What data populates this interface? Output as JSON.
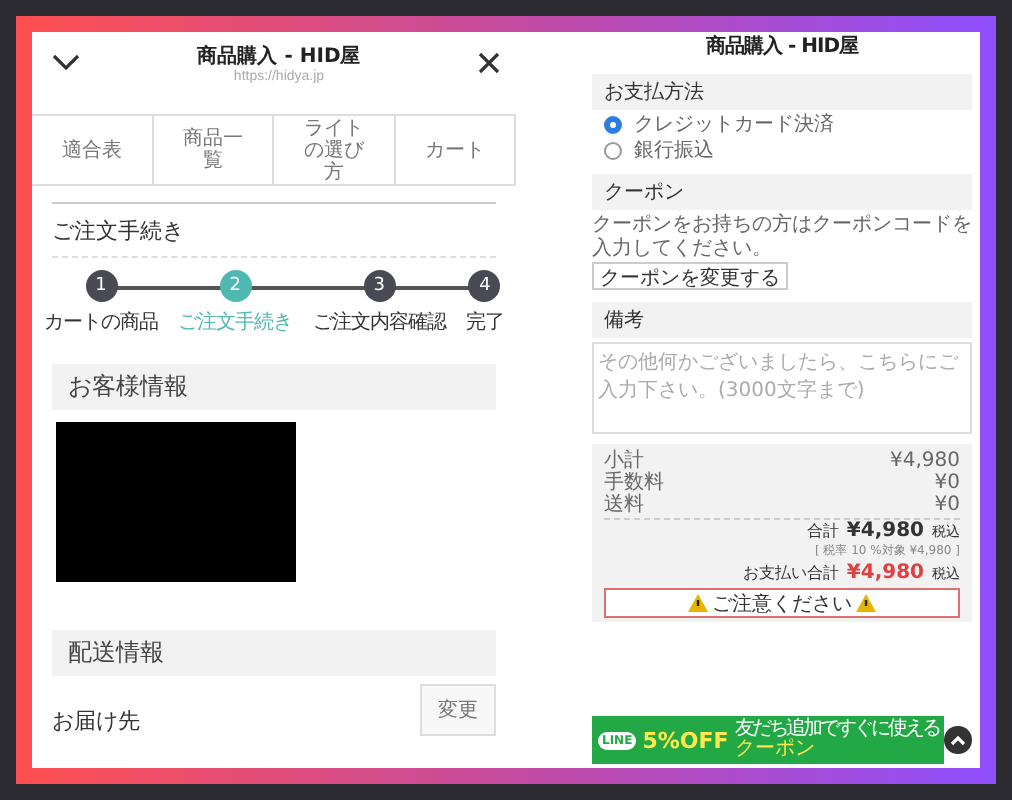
{
  "left_screen": {
    "header": {
      "title": "商品購入 - HID屋",
      "url": "https://hidya.jp"
    },
    "nav_tabs": [
      {
        "label": "適合表"
      },
      {
        "label": "商品一覧"
      },
      {
        "label": "ライトの選び方"
      },
      {
        "label": "カート"
      }
    ],
    "section_title": "ご注文手続き",
    "steps": [
      {
        "number": "1",
        "label": "カートの商品",
        "selected": false
      },
      {
        "number": "2",
        "label": "ご注文手続き",
        "selected": true
      },
      {
        "number": "3",
        "label": "ご注文内容確認",
        "selected": false
      },
      {
        "number": "4",
        "label": "完了",
        "selected": false
      }
    ],
    "customer_heading": "お客様情報",
    "shipping_heading": "配送情報",
    "destination_label": "お届け先",
    "change_button": "変更"
  },
  "right_screen": {
    "header": {
      "title": "商品購入 - HID屋"
    },
    "payment_heading": "お支払方法",
    "payment_options": [
      {
        "label": "クレジットカード決済",
        "selected": true
      },
      {
        "label": "銀行振込",
        "selected": false
      }
    ],
    "coupon_heading": "クーポン",
    "coupon_text": "クーポンをお持ちの方はクーポンコードを入力してください。",
    "coupon_button": "クーポンを変更する",
    "notes_heading": "備考",
    "notes_placeholder": "その他何かございましたら、こちらにご入力下さい。(3000文字まで)",
    "summary_rows": [
      {
        "label": "小計",
        "value": "¥4,980"
      },
      {
        "label": "手数料",
        "value": "¥0"
      },
      {
        "label": "送料",
        "value": "¥0"
      }
    ],
    "total": {
      "label": "合計",
      "value": "¥4,980",
      "suffix": "税込"
    },
    "tax_note": "[ 税率 10 %対象 ¥4,980 ]",
    "payment_total": {
      "label": "お支払い合計",
      "value": "¥4,980",
      "suffix": "税込"
    },
    "notice": "ご注意ください",
    "banner": {
      "badge": "LINE",
      "headline": "友だち追加ですぐに使える",
      "big": "5%OFF",
      "tag": "クーポン"
    }
  }
}
